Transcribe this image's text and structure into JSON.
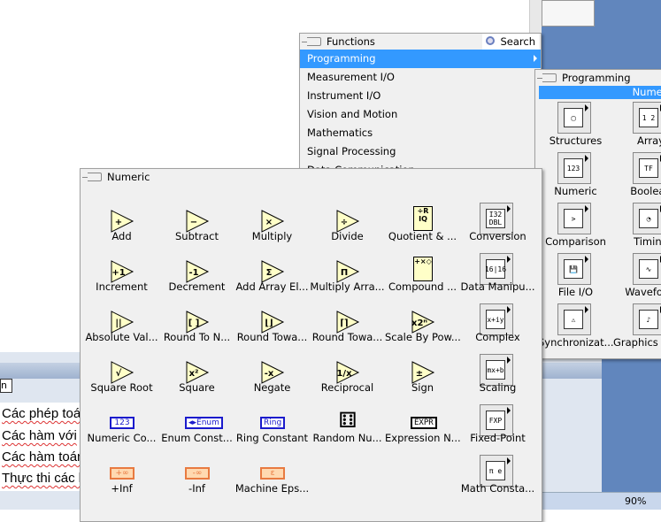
{
  "colors": {
    "accent": "#3399ff",
    "desktop": "#6186bd",
    "icon_fill": "#ffffc8"
  },
  "word": {
    "tab_text": "n",
    "lines": [
      "Các phép toá",
      "Các hàm với",
      "Các hàm toán",
      "Thực thi các l"
    ],
    "zoom": "90%"
  },
  "functions_palette": {
    "title": "Functions",
    "search_label": "Search",
    "items": [
      "Programming",
      "Measurement I/O",
      "Instrument I/O",
      "Vision and Motion",
      "Mathematics",
      "Signal Processing",
      "Data Communication"
    ],
    "selected": "Programming"
  },
  "programming_palette": {
    "title": "Programming",
    "selected_label": "Numeric",
    "items": [
      {
        "label": "Structures",
        "glyph": "▢"
      },
      {
        "label": "Array",
        "glyph": "1 2"
      },
      {
        "label": "Numeric",
        "glyph": "123"
      },
      {
        "label": "Boolean",
        "glyph": "TF"
      },
      {
        "label": "Comparison",
        "glyph": ">"
      },
      {
        "label": "Timing",
        "glyph": "◔"
      },
      {
        "label": "File I/O",
        "glyph": "💾"
      },
      {
        "label": "Waveform",
        "glyph": "∿"
      },
      {
        "label": "Synchronizat...",
        "glyph": "⚠"
      },
      {
        "label": "Graphics & Sound",
        "glyph": "♪"
      }
    ]
  },
  "numeric_palette": {
    "title": "Numeric",
    "items": [
      {
        "label": "Add",
        "kind": "tri",
        "glyph": "+"
      },
      {
        "label": "Subtract",
        "kind": "tri",
        "glyph": "−"
      },
      {
        "label": "Multiply",
        "kind": "tri",
        "glyph": "×"
      },
      {
        "label": "Divide",
        "kind": "tri",
        "glyph": "÷"
      },
      {
        "label": "Quotient & ...",
        "kind": "box",
        "glyph": "÷R IQ"
      },
      {
        "label": "Conversion",
        "kind": "sub",
        "glyph": "I32 DBL"
      },
      {
        "label": "Increment",
        "kind": "tri",
        "glyph": "+1"
      },
      {
        "label": "Decrement",
        "kind": "tri",
        "glyph": "-1"
      },
      {
        "label": "Add Array El...",
        "kind": "tri",
        "glyph": "Σ"
      },
      {
        "label": "Multiply Arra...",
        "kind": "tri",
        "glyph": "Π"
      },
      {
        "label": "Compound ...",
        "kind": "box",
        "glyph": "+×◇"
      },
      {
        "label": "Data Manipu...",
        "kind": "sub",
        "glyph": "16|16"
      },
      {
        "label": "Absolute Val...",
        "kind": "tri",
        "glyph": "||"
      },
      {
        "label": "Round To N...",
        "kind": "tri",
        "glyph": "[ ]"
      },
      {
        "label": "Round Towa...",
        "kind": "tri",
        "glyph": "⌊⌋"
      },
      {
        "label": "Round Towa...",
        "kind": "tri",
        "glyph": "⌈⌉"
      },
      {
        "label": "Scale By Pow...",
        "kind": "tri",
        "glyph": "x2ⁿ"
      },
      {
        "label": "Complex",
        "kind": "sub",
        "glyph": "x+iy"
      },
      {
        "label": "Square Root",
        "kind": "tri",
        "glyph": "√"
      },
      {
        "label": "Square",
        "kind": "tri",
        "glyph": "x²"
      },
      {
        "label": "Negate",
        "kind": "tri",
        "glyph": "-x"
      },
      {
        "label": "Reciprocal",
        "kind": "tri",
        "glyph": "1/x"
      },
      {
        "label": "Sign",
        "kind": "tri",
        "glyph": "±"
      },
      {
        "label": "Scaling",
        "kind": "sub",
        "glyph": "mx+b"
      },
      {
        "label": "Numeric Co...",
        "kind": "const",
        "glyph": "123"
      },
      {
        "label": "Enum Const...",
        "kind": "const",
        "glyph": "◂▸Enum"
      },
      {
        "label": "Ring Constant",
        "kind": "const",
        "glyph": "Ring"
      },
      {
        "label": "Random Nu...",
        "kind": "dice",
        "glyph": "⚅"
      },
      {
        "label": "Expression N...",
        "kind": "expr",
        "glyph": "EXPR"
      },
      {
        "label": "Fixed-Point",
        "kind": "sub",
        "glyph": "FXP"
      },
      {
        "label": "+Inf",
        "kind": "inf",
        "glyph": "+∞"
      },
      {
        "label": "-Inf",
        "kind": "inf",
        "glyph": "-∞"
      },
      {
        "label": "Machine Eps...",
        "kind": "inf",
        "glyph": "ε"
      },
      null,
      null,
      {
        "label": "Math Consta...",
        "kind": "sub",
        "glyph": "π e"
      }
    ]
  }
}
